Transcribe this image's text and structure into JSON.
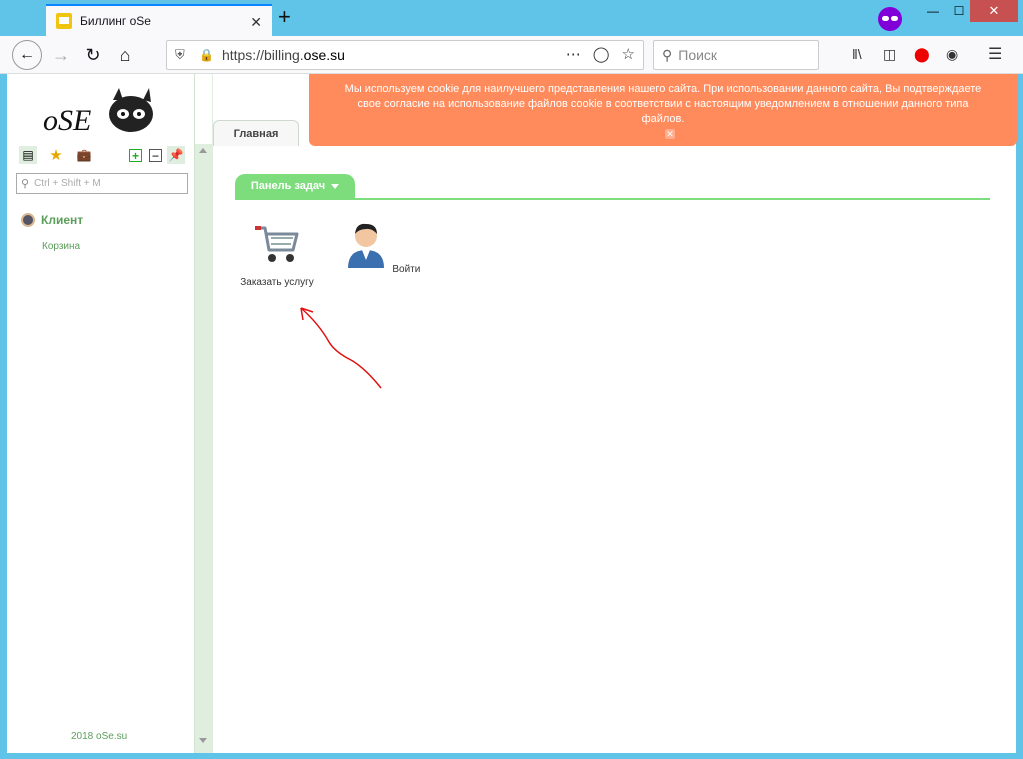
{
  "browser": {
    "tab_title": "Биллинг oSe",
    "tab_close": "✕",
    "new_tab": "+",
    "url_prefix": "https://billing.",
    "url_host": "ose.su",
    "search_placeholder": "Поиск",
    "win_min": "—",
    "win_max": "☐",
    "win_close": "✕"
  },
  "sidebar": {
    "search_placeholder": "Ctrl + Shift + M",
    "client_label": "Клиент",
    "cart_label": "Корзина",
    "footer": "2018 oSe.su"
  },
  "main": {
    "tab_label": "Главная",
    "cookie_text": "Мы используем cookie для наилучшего представления нашего сайта. При использовании данного сайта, Вы подтверждаете свое согласие на использование файлов cookie в соответствии с настоящим уведомлением в отношении данного типа файлов.",
    "cookie_close": "✕",
    "task_panel_label": "Панель задач",
    "tasks": [
      {
        "label": "Заказать услугу",
        "icon": "shopping-cart-icon"
      },
      {
        "label": "Войти",
        "icon": "user-icon"
      }
    ]
  },
  "colors": {
    "accent_green": "#7ddd7d",
    "cookie_bg": "#ff8a5b",
    "titlebar": "#5fc4e8"
  }
}
